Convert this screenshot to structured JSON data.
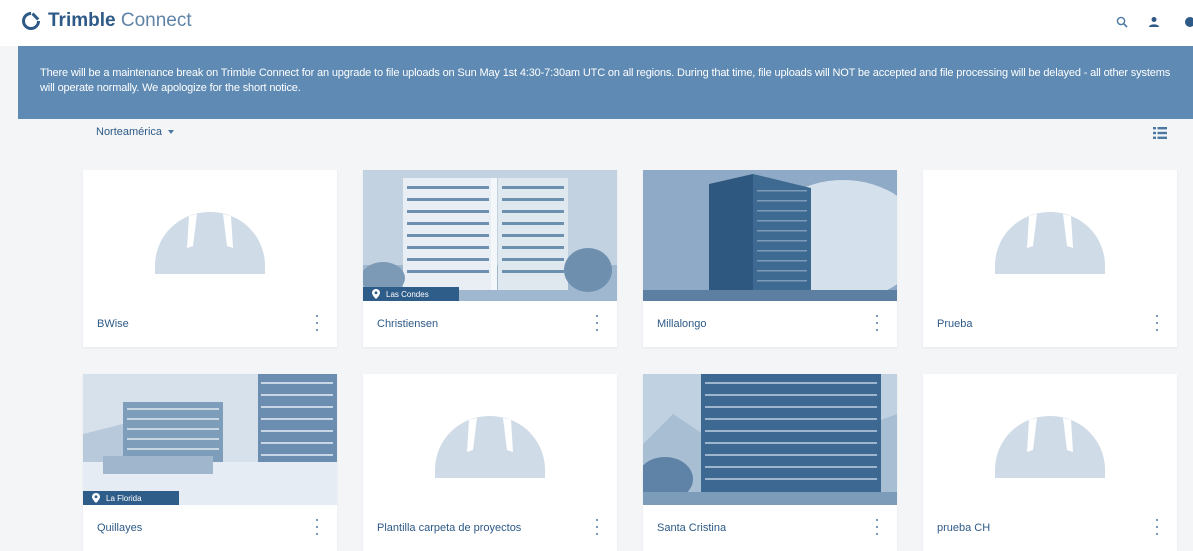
{
  "app": {
    "brand_bold": "Trimble",
    "brand_light": "Connect"
  },
  "header": {
    "icons": [
      "search-icon",
      "user-icon",
      "help-icon"
    ]
  },
  "banner": {
    "text": "There will be a maintenance break on Trimble Connect for an upgrade to file uploads on Sun May 1st 4:30-7:30am UTC on all regions. During that time, file uploads will NOT be accepted and file processing will be delayed - all other systems will operate normally. We apologize for the short notice."
  },
  "region": {
    "selected": "Norteamérica"
  },
  "projects": [
    {
      "name": "BWise",
      "image": "placeholder",
      "location": ""
    },
    {
      "name": "Christiensen",
      "image": "photo",
      "location": "Las Condes"
    },
    {
      "name": "Millalongo",
      "image": "photo",
      "location": ""
    },
    {
      "name": "Prueba",
      "image": "placeholder",
      "location": ""
    },
    {
      "name": "Quillayes",
      "image": "photo",
      "location": "La Florida"
    },
    {
      "name": "Plantilla carpeta de proyectos",
      "image": "placeholder",
      "location": ""
    },
    {
      "name": "Santa Cristina",
      "image": "photo",
      "location": ""
    },
    {
      "name": "prueba CH",
      "image": "placeholder",
      "location": ""
    }
  ],
  "colors": {
    "primary": "#2d5a86",
    "banner": "#5e8ab3",
    "background": "#f4f5f7",
    "placeholder_icon": "#cfdbe7"
  }
}
